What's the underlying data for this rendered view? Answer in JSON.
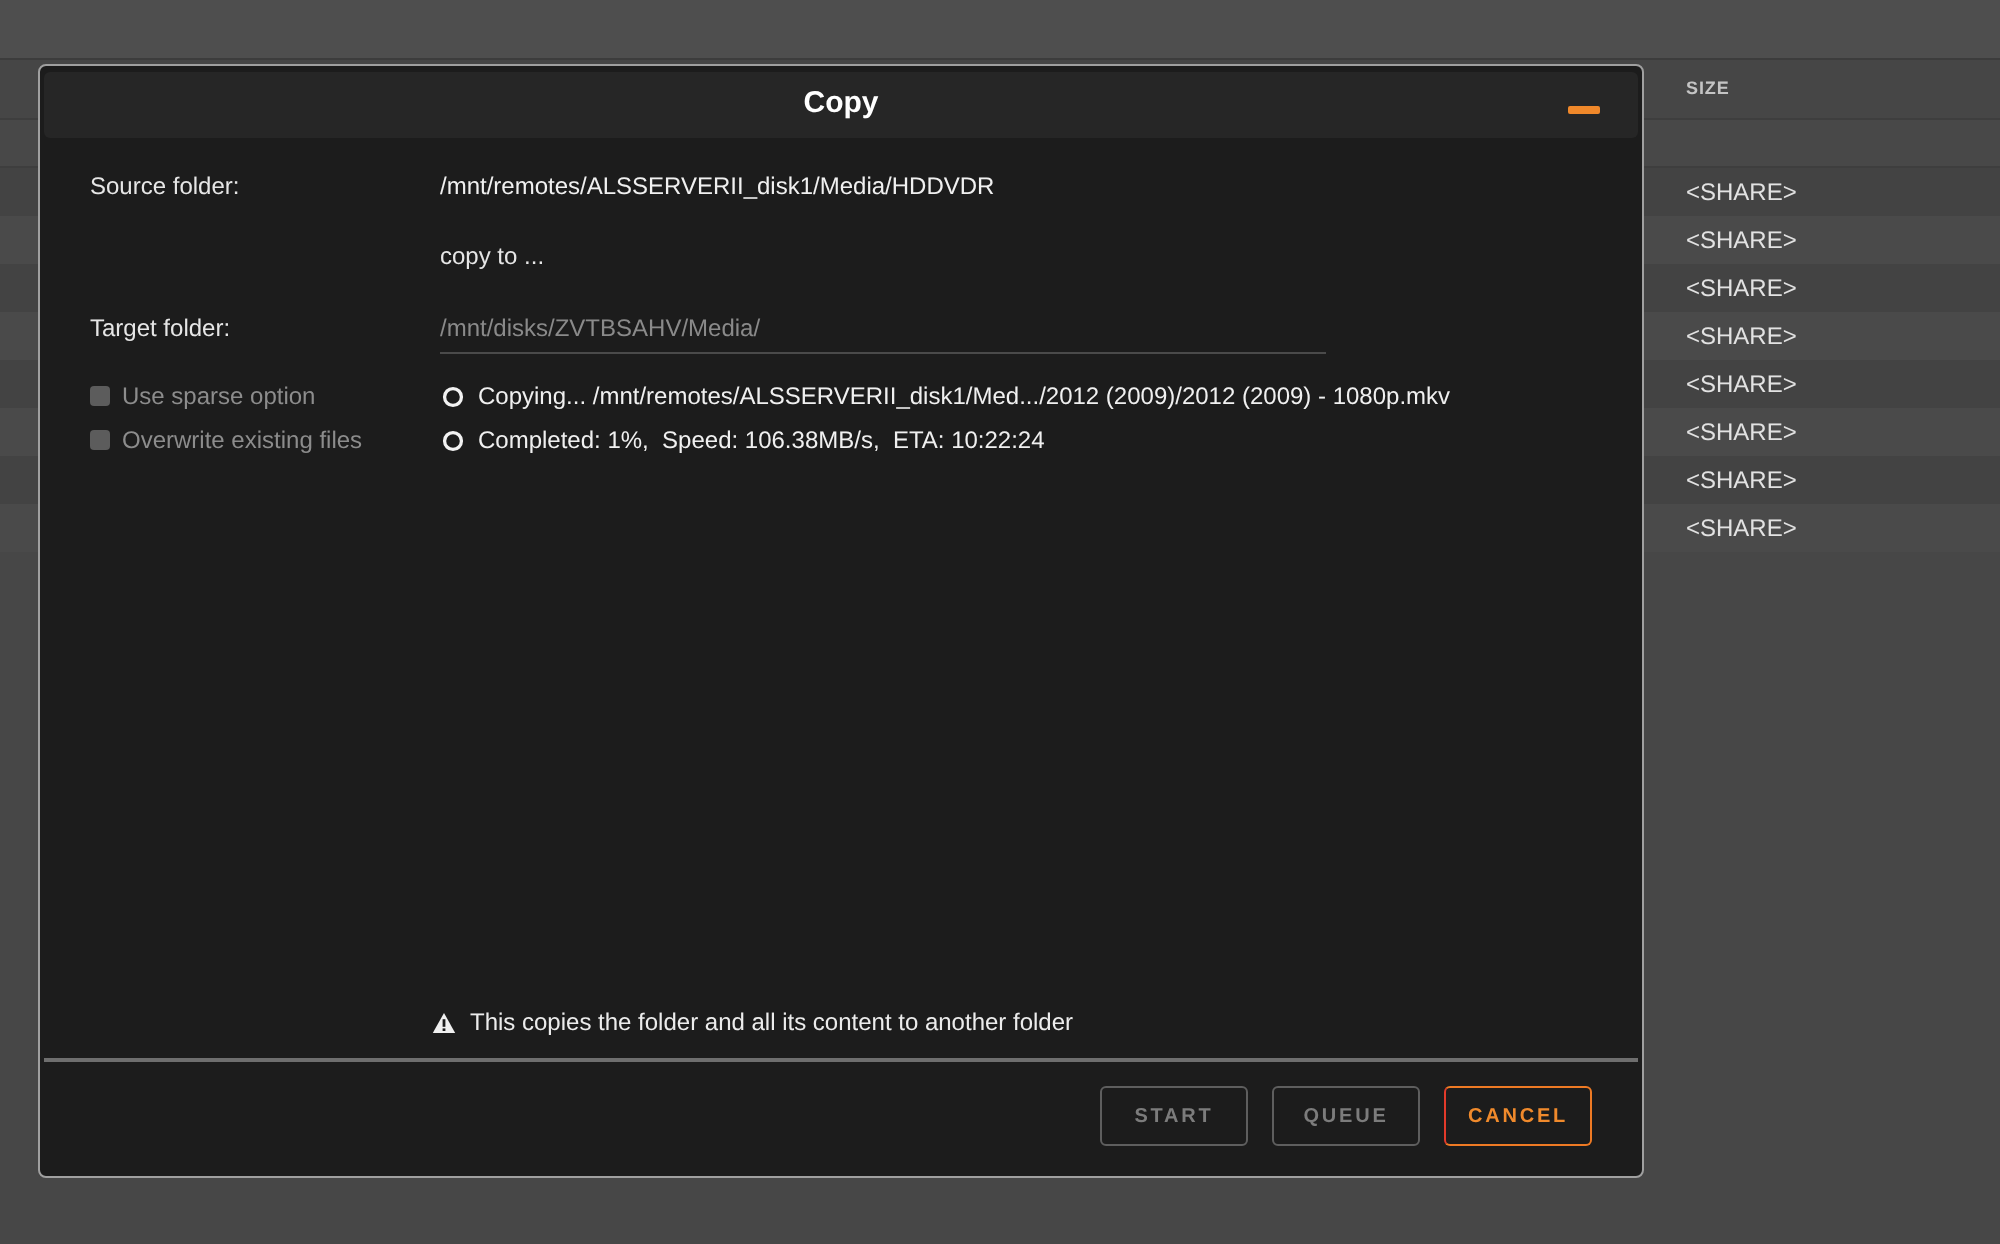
{
  "file_table": {
    "columns": [
      "SIZE"
    ],
    "rows": [
      {
        "size": "<SHARE>"
      },
      {
        "size": "<SHARE>"
      },
      {
        "size": "<SHARE>"
      },
      {
        "size": "<SHARE>"
      },
      {
        "size": "<SHARE>"
      },
      {
        "size": "<SHARE>"
      },
      {
        "size": "<SHARE>"
      },
      {
        "size": "<SHARE>"
      }
    ]
  },
  "dialog": {
    "title": "Copy",
    "source": {
      "label": "Source folder:",
      "value": "/mnt/remotes/ALSSERVERII_disk1/Media/HDDVDR"
    },
    "separator_text": "copy to ...",
    "target": {
      "label": "Target folder:",
      "value": "/mnt/disks/ZVTBSAHV/Media/",
      "disabled": true
    },
    "options": [
      {
        "label": "Use sparse option",
        "checked": false,
        "disabled": true
      },
      {
        "label": "Overwrite existing files",
        "checked": false,
        "disabled": true
      }
    ],
    "status_lines": [
      "Copying... /mnt/remotes/ALSSERVERII_disk1/Med.../2012 (2009)/2012 (2009) - 1080p.mkv",
      "Completed: 1%,  Speed: 106.38MB/s,  ETA: 10:22:24"
    ],
    "note": "This copies the folder and all its content to another folder",
    "buttons": [
      {
        "label": "START",
        "disabled": true
      },
      {
        "label": "QUEUE",
        "disabled": true
      },
      {
        "label": "CANCEL",
        "disabled": false
      }
    ]
  }
}
